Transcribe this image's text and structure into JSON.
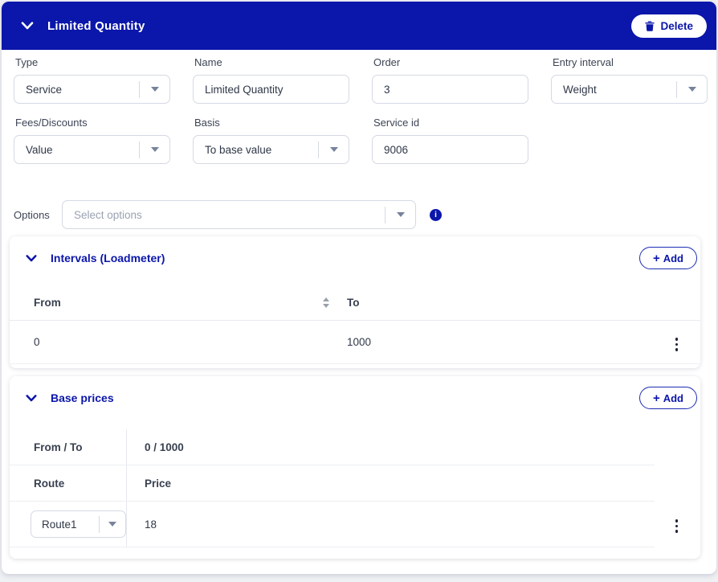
{
  "colors": {
    "primary": "#0b16aa",
    "header_bg": "#0b16aa",
    "label_text": "#3d4454",
    "value_text": "#2f3747",
    "placeholder_text": "#9aa3b0",
    "control_border": "#d5d9e3",
    "table_border": "#e9ebf0"
  },
  "header": {
    "title": "Limited Quantity",
    "delete_button": {
      "icon": "trash-icon",
      "label": "Delete"
    }
  },
  "form": {
    "fields": [
      {
        "label": "Type",
        "value": "Service",
        "control": "select"
      },
      {
        "label": "Name",
        "value": "Limited Quantity",
        "control": "text-input"
      },
      {
        "label": "Order",
        "value": "3",
        "control": "text-input"
      },
      {
        "label": "Entry interval",
        "value": "Weight",
        "control": "select"
      },
      {
        "label": "Fees/Discounts",
        "value": "Value",
        "control": "select"
      },
      {
        "label": "Basis",
        "value": "To base value",
        "control": "select"
      },
      {
        "label": "Service id",
        "value": "9006",
        "control": "text-input"
      }
    ],
    "options": {
      "label": "Options",
      "placeholder": "Select options",
      "info_icon": "i"
    }
  },
  "intervals_panel": {
    "title": "Intervals (Loadmeter)",
    "add_button": {
      "icon_glyph": "+",
      "label": "Add"
    },
    "columns": {
      "from": "From",
      "to": "To"
    },
    "rows": [
      {
        "from": "0",
        "to": "1000"
      }
    ]
  },
  "base_prices_panel": {
    "title": "Base prices",
    "add_button": {
      "icon_glyph": "+",
      "label": "Add"
    },
    "labels": {
      "from_to": "From / To",
      "route": "Route",
      "price": "Price"
    },
    "values": {
      "from_to": "0 / 1000"
    },
    "rows": [
      {
        "route": "Route1",
        "price": "18"
      }
    ]
  }
}
